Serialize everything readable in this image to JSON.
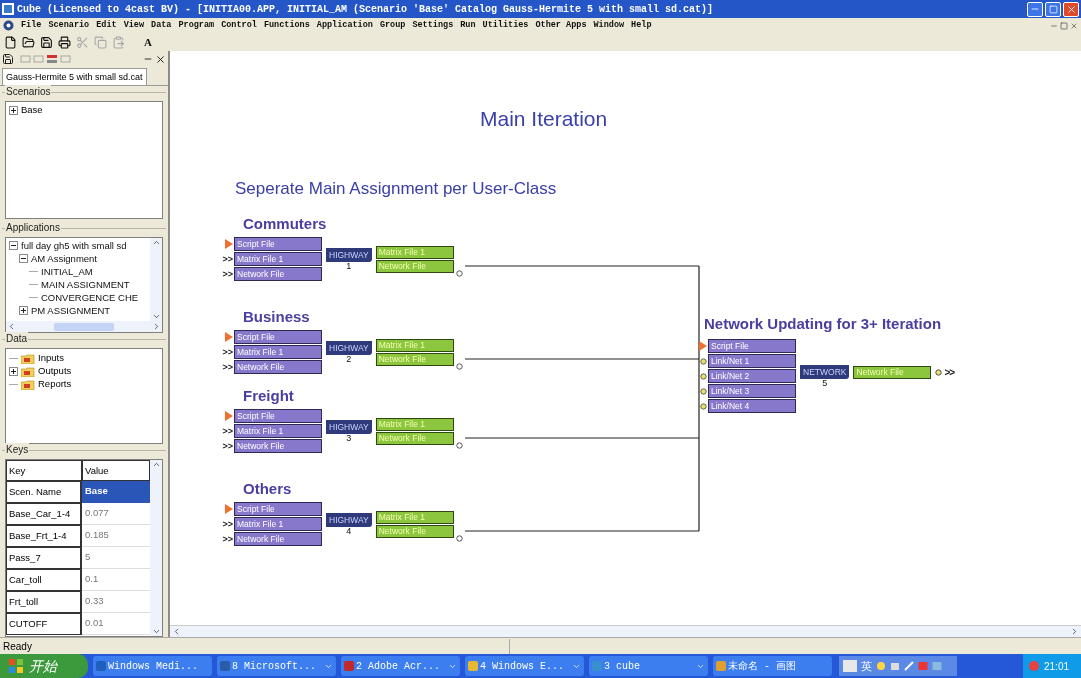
{
  "window": {
    "title": "Cube (Licensed to 4cast BV) - [INITIA00.APP, INITIAL_AM (Scenario 'Base' Catalog Gauss-Hermite 5 with small sd.cat)]"
  },
  "menu": [
    "File",
    "Scenario",
    "Edit",
    "View",
    "Data",
    "Program",
    "Control",
    "Functions",
    "Application",
    "Group",
    "Settings",
    "Run",
    "Utilities",
    "Other Apps",
    "Window",
    "Help"
  ],
  "toolbar": {
    "items": [
      {
        "kind": "new",
        "disabled": false
      },
      {
        "kind": "open",
        "disabled": false
      },
      {
        "kind": "save",
        "disabled": false
      },
      {
        "kind": "print",
        "disabled": false
      },
      {
        "kind": "cut",
        "disabled": true
      },
      {
        "kind": "copy",
        "disabled": true
      },
      {
        "kind": "paste",
        "disabled": true
      }
    ],
    "text": "A"
  },
  "catalog_tab": "Gauss-Hermite 5 with small sd.cat",
  "scenarios": {
    "title": "Scenarios",
    "items": [
      {
        "label": "Base",
        "expanded": false
      }
    ]
  },
  "applications": {
    "title": "Applications",
    "items": [
      {
        "label": "full day gh5 with small sd",
        "expanded": true,
        "children": [
          {
            "label": "AM Assignment",
            "expanded": true,
            "children": [
              {
                "label": "INITIAL_AM"
              },
              {
                "label": "MAIN ASSIGNMENT"
              },
              {
                "label": "CONVERGENCE CHE"
              }
            ]
          },
          {
            "label": "PM ASSIGNMENT",
            "expanded": false
          }
        ]
      }
    ]
  },
  "data": {
    "title": "Data",
    "items": [
      {
        "label": "Inputs",
        "kind": "leaf"
      },
      {
        "label": "Outputs",
        "kind": "branch"
      },
      {
        "label": "Reports",
        "kind": "leaf"
      }
    ]
  },
  "keys": {
    "title": "Keys",
    "columns": [
      "Key",
      "Value"
    ],
    "rows": [
      {
        "key": "Scen. Name",
        "value": "Base",
        "selected": true
      },
      {
        "key": "Base_Car_1-4",
        "value": "0.077",
        "selected": false
      },
      {
        "key": "Base_Frt_1-4",
        "value": "0.185",
        "selected": false
      },
      {
        "key": "Pass_7",
        "value": "5",
        "selected": false
      },
      {
        "key": "Car_toll",
        "value": "0.1",
        "selected": false
      },
      {
        "key": "Frt_toll",
        "value": "0.33",
        "selected": false
      },
      {
        "key": "CUTOFF",
        "value": "0.01",
        "selected": false
      }
    ]
  },
  "canvas": {
    "title": "Main Iteration",
    "subtitle": "Seperate Main Assignment per User-Class",
    "groups": [
      {
        "label": "Commuters",
        "inputs": [
          {
            "label": "Script File",
            "kind": "script"
          },
          {
            "label": "Matrix File 1",
            "kind": "file",
            "marker": ">>"
          },
          {
            "label": "Network File",
            "kind": "file",
            "marker": ">>"
          }
        ],
        "program": "HIGHWAY",
        "number": "1",
        "outputs": [
          "Matrix File 1",
          "Network File"
        ]
      },
      {
        "label": "Business",
        "inputs": [
          {
            "label": "Script File",
            "kind": "script"
          },
          {
            "label": "Matrix File 1",
            "kind": "file",
            "marker": ">>"
          },
          {
            "label": "Network File",
            "kind": "file",
            "marker": ">>"
          }
        ],
        "program": "HIGHWAY",
        "number": "2",
        "outputs": [
          "Matrix File 1",
          "Network File"
        ]
      },
      {
        "label": "Freight",
        "inputs": [
          {
            "label": "Script File",
            "kind": "script"
          },
          {
            "label": "Matrix File 1",
            "kind": "file",
            "marker": ">>"
          },
          {
            "label": "Network File",
            "kind": "file",
            "marker": ">>"
          }
        ],
        "program": "HIGHWAY",
        "number": "3",
        "outputs": [
          "Matrix File 1",
          "Network File"
        ]
      },
      {
        "label": "Others",
        "inputs": [
          {
            "label": "Script File",
            "kind": "script"
          },
          {
            "label": "Matrix File 1",
            "kind": "file",
            "marker": ">>"
          },
          {
            "label": "Network File",
            "kind": "file",
            "marker": ">>"
          }
        ],
        "program": "HIGHWAY",
        "number": "4",
        "outputs": [
          "Matrix File 1",
          "Network File"
        ]
      }
    ],
    "network": {
      "label": "Network Updating for 3+ Iteration",
      "inputs": [
        {
          "label": "Script File",
          "kind": "script"
        },
        {
          "label": "Link/Net 1",
          "kind": "link"
        },
        {
          "label": "Link/Net 2",
          "kind": "link"
        },
        {
          "label": "Link/Net 3",
          "kind": "link"
        },
        {
          "label": "Link/Net 4",
          "kind": "link"
        }
      ],
      "program": "NETWORK",
      "number": "5",
      "outputs": [
        "Network File"
      ],
      "output_marker": ">>"
    }
  },
  "status_bar": "Ready",
  "taskbar": {
    "start": "开始",
    "items": [
      {
        "label": "Windows Medi...",
        "grouped": false,
        "color": "#1d5fbf"
      },
      {
        "label": "8 Microsoft...",
        "grouped": true,
        "color": "#2a5caa"
      },
      {
        "label": "2 Adobe Acr...",
        "grouped": true,
        "color": "#c0282d"
      },
      {
        "label": "4 Windows E...",
        "grouped": true,
        "color": "#e8b830"
      },
      {
        "label": "3 cube",
        "grouped": true,
        "color": "#3a8fd0"
      },
      {
        "label": "未命名 - 画图",
        "grouped": false,
        "color": "#e0a030"
      }
    ],
    "ime": "英",
    "clock": "21:01"
  }
}
